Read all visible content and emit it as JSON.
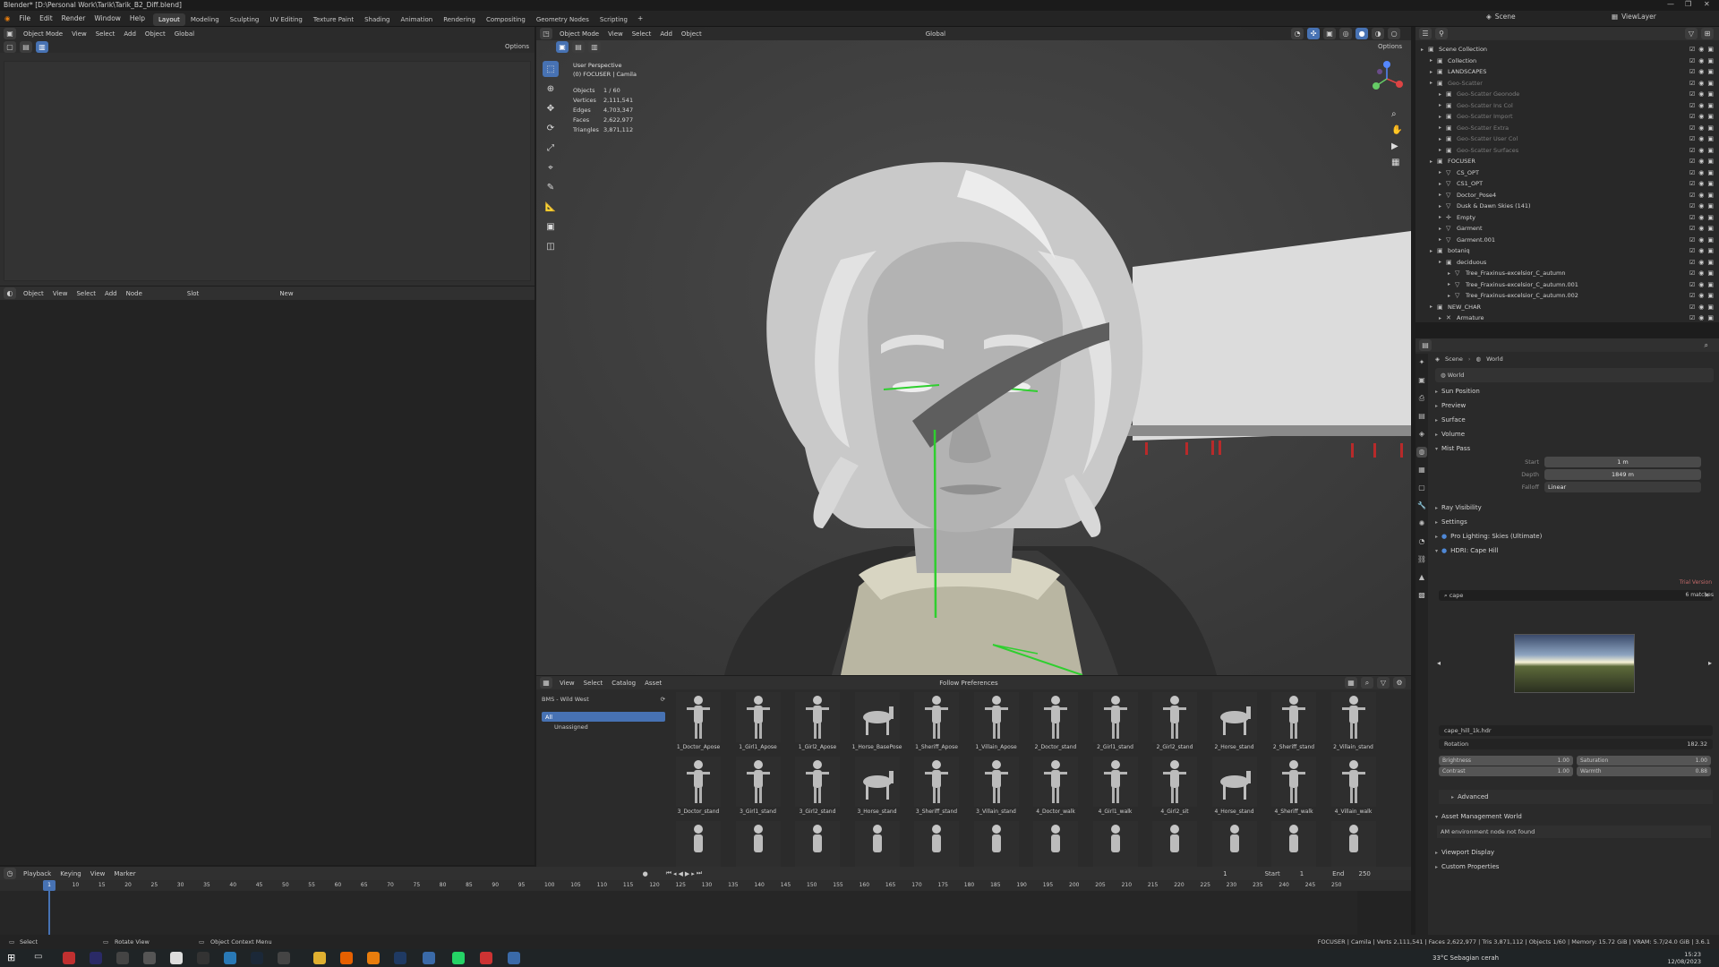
{
  "window": {
    "title": "Blender* [D:\\Personal Work\\Tarik\\Tarik_B2_Diff.blend]"
  },
  "menu": {
    "file_items": [
      "File",
      "Edit",
      "Render",
      "Window",
      "Help"
    ],
    "workspaces": [
      "Layout",
      "Modeling",
      "Sculpting",
      "UV Editing",
      "Texture Paint",
      "Shading",
      "Animation",
      "Rendering",
      "Compositing",
      "Geometry Nodes",
      "Scripting"
    ],
    "active_workspace": "Layout",
    "scene": "Scene",
    "view_layer": "ViewLayer"
  },
  "left_top_editor": {
    "mode": "Object Mode",
    "items": [
      "View",
      "Select",
      "Add",
      "Object"
    ],
    "transform": "Global",
    "options": "Options"
  },
  "node_editor": {
    "mode": "Object",
    "items": [
      "View",
      "Select",
      "Add",
      "Node"
    ],
    "new": "New",
    "slot": "Slot"
  },
  "viewport": {
    "mode": "Object Mode",
    "menus": [
      "View",
      "Select",
      "Add",
      "Object"
    ],
    "transform": "Global",
    "options": "Options",
    "perspective": "User Perspective",
    "collection_label": "(0) FOCUSER | Camila",
    "stats": [
      {
        "k": "Objects",
        "v": "1 / 60"
      },
      {
        "k": "Vertices",
        "v": "2,111,541"
      },
      {
        "k": "Edges",
        "v": "4,703,347"
      },
      {
        "k": "Faces",
        "v": "2,622,977"
      },
      {
        "k": "Triangles",
        "v": "3,871,112"
      }
    ]
  },
  "outliner": {
    "title": "Scene Collection",
    "rows": [
      {
        "indent": 0,
        "label": "Scene Collection",
        "icon": "collection-icon"
      },
      {
        "indent": 1,
        "label": "Collection",
        "icon": "collection-icon"
      },
      {
        "indent": 1,
        "label": "LANDSCAPES",
        "icon": "collection-icon"
      },
      {
        "indent": 1,
        "label": "Geo-Scatter",
        "icon": "collection-icon",
        "dim": true
      },
      {
        "indent": 2,
        "label": "Geo-Scatter Geonode",
        "icon": "collection-icon",
        "dim": true
      },
      {
        "indent": 2,
        "label": "Geo-Scatter Ins Col",
        "icon": "collection-icon",
        "dim": true
      },
      {
        "indent": 2,
        "label": "Geo-Scatter Import",
        "icon": "collection-icon",
        "dim": true
      },
      {
        "indent": 2,
        "label": "Geo-Scatter Extra",
        "icon": "collection-icon",
        "dim": true
      },
      {
        "indent": 2,
        "label": "Geo-Scatter User Col",
        "icon": "collection-icon",
        "dim": true
      },
      {
        "indent": 2,
        "label": "Geo-Scatter Surfaces",
        "icon": "collection-icon",
        "dim": true
      },
      {
        "indent": 1,
        "label": "FOCUSER",
        "icon": "collection-icon"
      },
      {
        "indent": 2,
        "label": "CS_OPT",
        "icon": "mesh-icon"
      },
      {
        "indent": 2,
        "label": "CS1_OPT",
        "icon": "mesh-icon"
      },
      {
        "indent": 2,
        "label": "Doctor_Pose4",
        "icon": "mesh-icon"
      },
      {
        "indent": 2,
        "label": "Dusk & Dawn Skies (141)",
        "icon": "mesh-icon"
      },
      {
        "indent": 2,
        "label": "Empty",
        "icon": "empty-icon"
      },
      {
        "indent": 2,
        "label": "Garment",
        "icon": "mesh-icon"
      },
      {
        "indent": 2,
        "label": "Garment.001",
        "icon": "mesh-icon"
      },
      {
        "indent": 1,
        "label": "botaniq",
        "icon": "collection-icon"
      },
      {
        "indent": 2,
        "label": "deciduous",
        "icon": "collection-icon"
      },
      {
        "indent": 3,
        "label": "Tree_Fraxinus-excelsior_C_autumn",
        "icon": "mesh-icon"
      },
      {
        "indent": 3,
        "label": "Tree_Fraxinus-excelsior_C_autumn.001",
        "icon": "mesh-icon"
      },
      {
        "indent": 3,
        "label": "Tree_Fraxinus-excelsior_C_autumn.002",
        "icon": "mesh-icon"
      },
      {
        "indent": 1,
        "label": "NEW_CHAR",
        "icon": "collection-icon"
      },
      {
        "indent": 2,
        "label": "Armature",
        "icon": "armature-icon"
      }
    ]
  },
  "properties": {
    "breadcrumb": [
      "Scene",
      "World"
    ],
    "world_name": "World",
    "sections_top": [
      "Sun Position",
      "Preview",
      "Surface",
      "Volume",
      "Mist Pass"
    ],
    "mist": {
      "start_label": "Start",
      "start": "1 m",
      "depth_label": "Depth",
      "depth": "1849 m",
      "falloff_label": "Falloff",
      "falloff": "Linear"
    },
    "sections_mid": [
      "Ray Visibility",
      "Settings"
    ],
    "addons": [
      "Pro Lighting: Skies (Ultimate)",
      "HDRI: Cape Hill"
    ],
    "trial": "Trial Version",
    "search_value": "cape",
    "matches": "6 matches",
    "hdri_file": "cape_hill_1k.hdr",
    "rotation_label": "Rotation",
    "rotation": "182.32",
    "brightness_label": "Brightness",
    "brightness": "1.00",
    "saturation_label": "Saturation",
    "saturation": "1.00",
    "contrast_label": "Contrast",
    "contrast": "1.00",
    "warmth_label": "Warmth",
    "warmth": "0.88",
    "advanced": "Advanced",
    "asset_mgmt": "Asset Management World",
    "asset_msg": "AM environment node not found",
    "viewport_display": "Viewport Display",
    "custom_props": "Custom Properties"
  },
  "asset_browser": {
    "menus": [
      "View",
      "Select",
      "Catalog",
      "Asset"
    ],
    "prefs": "Follow Preferences",
    "library": "BMS - Wild West",
    "catalog_all": "All",
    "catalog_unassigned": "Unassigned",
    "assets": [
      "1_Doctor_Apose",
      "1_Girl1_Apose",
      "1_Girl2_Apose",
      "1_Horse_BasePose",
      "1_Sheriff_Apose",
      "1_Villain_Apose",
      "2_Doctor_stand",
      "2_Girl1_stand",
      "2_Girl2_stand",
      "2_Horse_stand",
      "2_Sheriff_stand",
      "2_Villain_stand",
      "3_Doctor_stand",
      "3_Girl1_stand",
      "3_Girl2_stand",
      "3_Horse_stand",
      "3_Sheriff_stand",
      "3_Villain_stand",
      "4_Doctor_walk",
      "4_Girl1_walk",
      "4_Girl2_sit",
      "4_Horse_stand",
      "4_Sheriff_walk",
      "4_Villain_walk"
    ]
  },
  "timeline": {
    "menus": [
      "Playback",
      "Keying",
      "View",
      "Marker"
    ],
    "current_frame": "1",
    "start_label": "Start",
    "start": "1",
    "end_label": "End",
    "end": "250",
    "ticks": [
      "5",
      "10",
      "15",
      "20",
      "25",
      "30",
      "35",
      "40",
      "45",
      "50",
      "55",
      "60",
      "65",
      "70",
      "75",
      "80",
      "85",
      "90",
      "95",
      "100",
      "105",
      "110",
      "115",
      "120",
      "125",
      "130",
      "135",
      "140",
      "145",
      "150",
      "155",
      "160",
      "165",
      "170",
      "175",
      "180",
      "185",
      "190",
      "195",
      "200",
      "205",
      "210",
      "215",
      "220",
      "225",
      "230",
      "235",
      "240",
      "245",
      "250"
    ]
  },
  "status": {
    "select": "Select",
    "rotate": "Rotate View",
    "context": "Object Context Menu",
    "right": "FOCUSER | Camila | Verts 2,111,541 | Faces 2,622,977 | Tris 3,871,112 | Objects 1/60 | Memory: 15.72 GiB | VRAM: 5.7/24.0 GiB | 3.6.1"
  },
  "taskbar": {
    "weather": "33°C  Sebagian cerah",
    "time": "15:23",
    "date": "12/08/2023"
  }
}
